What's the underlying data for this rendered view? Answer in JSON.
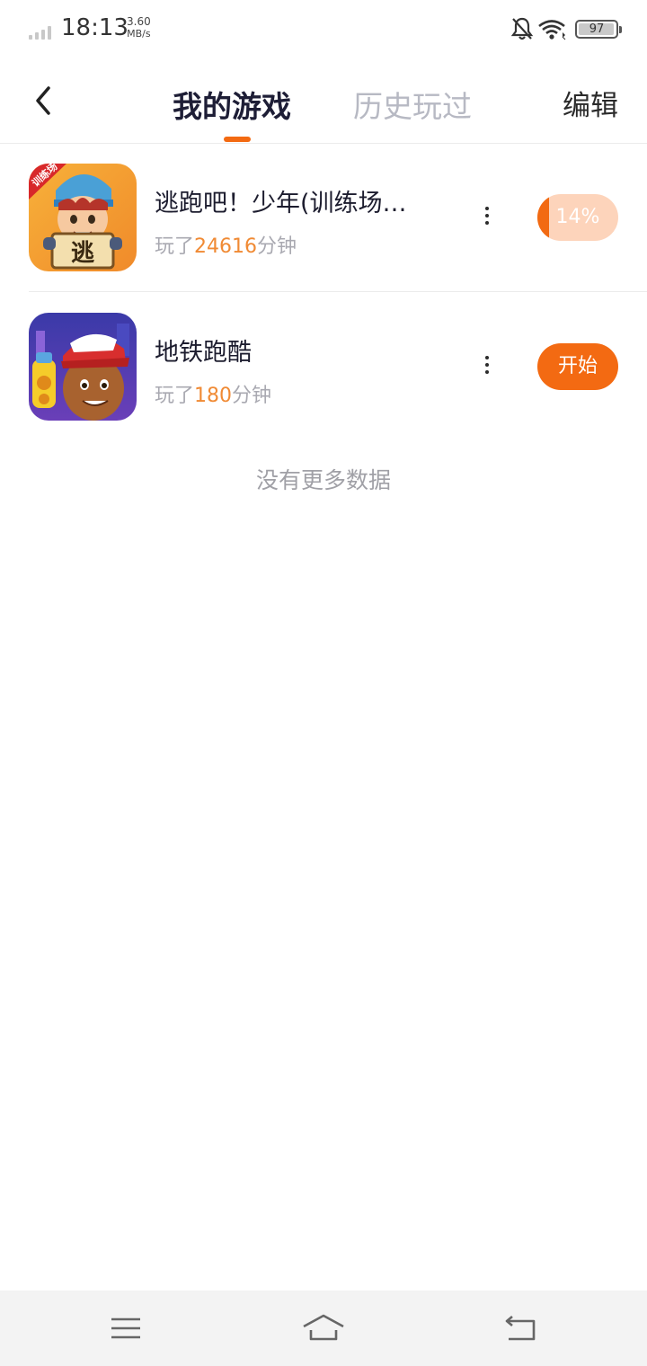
{
  "status_bar": {
    "time": "18:13",
    "speed_value": "3.60",
    "speed_unit": "MB/s",
    "battery": "97",
    "battery_level": 0.97,
    "icons": [
      "signal-icon",
      "bell-off-icon",
      "wifi-icon",
      "battery-icon"
    ]
  },
  "header": {
    "tabs": [
      {
        "label": "我的游戏",
        "active": true
      },
      {
        "label": "历史玩过",
        "active": false
      }
    ],
    "edit_label": "编辑"
  },
  "games": [
    {
      "name": "逃跑吧！少年(训练场…",
      "played_prefix": "玩了",
      "played_minutes": "24616",
      "played_suffix": "分钟",
      "badge_text": "训练场",
      "icon_char": "逃",
      "action_label": "14%",
      "progress": 0.14
    },
    {
      "name": "地铁跑酷",
      "played_prefix": "玩了",
      "played_minutes": "180",
      "played_suffix": "分钟",
      "action_label": "开始"
    }
  ],
  "footer_text": "没有更多数据",
  "colors": {
    "accent": "#f36a12",
    "accent_light": "#fdd4bb",
    "minutes_text": "#f08a34"
  }
}
